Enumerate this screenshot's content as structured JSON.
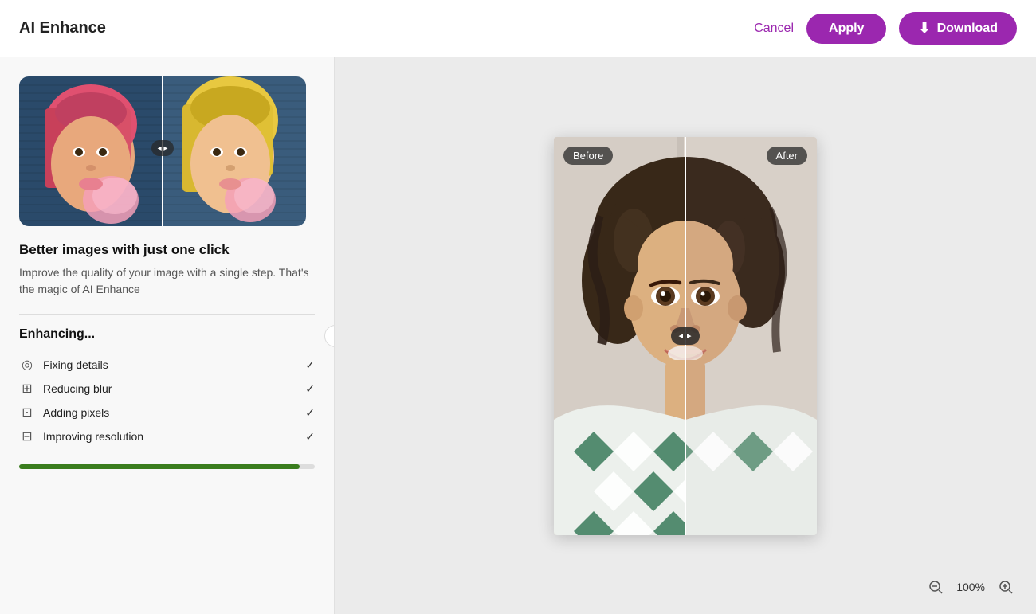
{
  "header": {
    "title": "AI Enhance",
    "cancel_label": "Cancel",
    "apply_label": "Apply",
    "download_label": "Download"
  },
  "panel": {
    "heading": "Better images with just one click",
    "description": "Improve the quality of your image with a single step. That's the magic of AI Enhance",
    "enhancing_title": "Enhancing...",
    "enhance_items": [
      {
        "icon": "fix-details-icon",
        "label": "Fixing details",
        "done": true
      },
      {
        "icon": "reduce-blur-icon",
        "label": "Reducing blur",
        "done": true
      },
      {
        "icon": "add-pixels-icon",
        "label": "Adding pixels",
        "done": true
      },
      {
        "icon": "improve-res-icon",
        "label": "Improving resolution",
        "done": true
      }
    ],
    "progress": 95
  },
  "compare": {
    "before_label": "Before",
    "after_label": "After"
  },
  "zoom": {
    "level": "100%",
    "zoom_in_label": "+",
    "zoom_out_label": "−"
  }
}
